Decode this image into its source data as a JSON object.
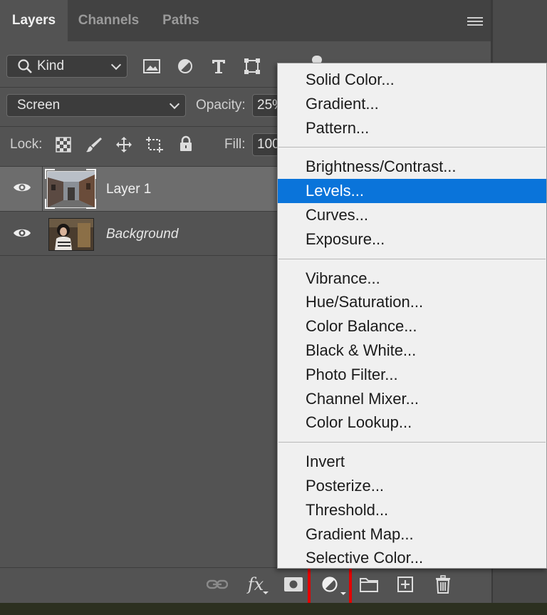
{
  "tabs": [
    {
      "label": "Layers",
      "active": true
    },
    {
      "label": "Channels",
      "active": false
    },
    {
      "label": "Paths",
      "active": false
    }
  ],
  "filter": {
    "label": "Kind"
  },
  "blend": {
    "mode": "Screen",
    "opacity_label": "Opacity:",
    "opacity_value": "25%",
    "fill_label": "Fill:",
    "fill_value": "100%"
  },
  "lock": {
    "label": "Lock:"
  },
  "layers": [
    {
      "name": "Layer 1",
      "selected": true,
      "italic": false
    },
    {
      "name": "Background",
      "selected": false,
      "italic": true
    }
  ],
  "menu": {
    "groups": [
      [
        "Solid Color...",
        "Gradient...",
        "Pattern..."
      ],
      [
        "Brightness/Contrast...",
        "Levels...",
        "Curves...",
        "Exposure..."
      ],
      [
        "Vibrance...",
        "Hue/Saturation...",
        "Color Balance...",
        "Black & White...",
        "Photo Filter...",
        "Channel Mixer...",
        "Color Lookup..."
      ],
      [
        "Invert",
        "Posterize...",
        "Threshold...",
        "Gradient Map...",
        "Selective Color..."
      ]
    ],
    "highlighted": "Levels..."
  },
  "bottom_bar": {
    "fx_label": "fx",
    "highlighted_button": "adjustment-layer-button",
    "highlight_color": "#e30000"
  },
  "colors": {
    "menu_highlight": "#0a74da",
    "panel_bg": "#535353"
  }
}
